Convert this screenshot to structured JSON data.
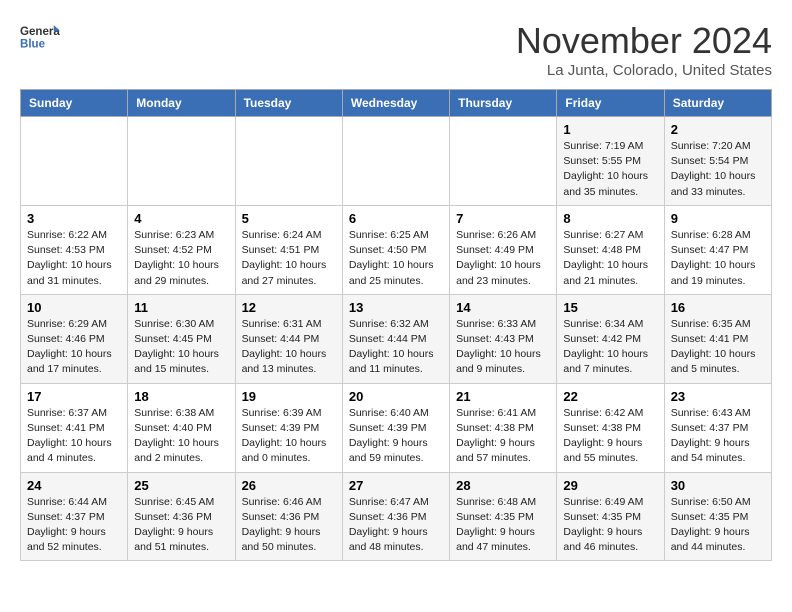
{
  "logo": {
    "line1": "General",
    "line2": "Blue"
  },
  "title": "November 2024",
  "subtitle": "La Junta, Colorado, United States",
  "weekdays": [
    "Sunday",
    "Monday",
    "Tuesday",
    "Wednesday",
    "Thursday",
    "Friday",
    "Saturday"
  ],
  "weeks": [
    [
      {
        "day": "",
        "info": ""
      },
      {
        "day": "",
        "info": ""
      },
      {
        "day": "",
        "info": ""
      },
      {
        "day": "",
        "info": ""
      },
      {
        "day": "",
        "info": ""
      },
      {
        "day": "1",
        "info": "Sunrise: 7:19 AM\nSunset: 5:55 PM\nDaylight: 10 hours\nand 35 minutes."
      },
      {
        "day": "2",
        "info": "Sunrise: 7:20 AM\nSunset: 5:54 PM\nDaylight: 10 hours\nand 33 minutes."
      }
    ],
    [
      {
        "day": "3",
        "info": "Sunrise: 6:22 AM\nSunset: 4:53 PM\nDaylight: 10 hours\nand 31 minutes."
      },
      {
        "day": "4",
        "info": "Sunrise: 6:23 AM\nSunset: 4:52 PM\nDaylight: 10 hours\nand 29 minutes."
      },
      {
        "day": "5",
        "info": "Sunrise: 6:24 AM\nSunset: 4:51 PM\nDaylight: 10 hours\nand 27 minutes."
      },
      {
        "day": "6",
        "info": "Sunrise: 6:25 AM\nSunset: 4:50 PM\nDaylight: 10 hours\nand 25 minutes."
      },
      {
        "day": "7",
        "info": "Sunrise: 6:26 AM\nSunset: 4:49 PM\nDaylight: 10 hours\nand 23 minutes."
      },
      {
        "day": "8",
        "info": "Sunrise: 6:27 AM\nSunset: 4:48 PM\nDaylight: 10 hours\nand 21 minutes."
      },
      {
        "day": "9",
        "info": "Sunrise: 6:28 AM\nSunset: 4:47 PM\nDaylight: 10 hours\nand 19 minutes."
      }
    ],
    [
      {
        "day": "10",
        "info": "Sunrise: 6:29 AM\nSunset: 4:46 PM\nDaylight: 10 hours\nand 17 minutes."
      },
      {
        "day": "11",
        "info": "Sunrise: 6:30 AM\nSunset: 4:45 PM\nDaylight: 10 hours\nand 15 minutes."
      },
      {
        "day": "12",
        "info": "Sunrise: 6:31 AM\nSunset: 4:44 PM\nDaylight: 10 hours\nand 13 minutes."
      },
      {
        "day": "13",
        "info": "Sunrise: 6:32 AM\nSunset: 4:44 PM\nDaylight: 10 hours\nand 11 minutes."
      },
      {
        "day": "14",
        "info": "Sunrise: 6:33 AM\nSunset: 4:43 PM\nDaylight: 10 hours\nand 9 minutes."
      },
      {
        "day": "15",
        "info": "Sunrise: 6:34 AM\nSunset: 4:42 PM\nDaylight: 10 hours\nand 7 minutes."
      },
      {
        "day": "16",
        "info": "Sunrise: 6:35 AM\nSunset: 4:41 PM\nDaylight: 10 hours\nand 5 minutes."
      }
    ],
    [
      {
        "day": "17",
        "info": "Sunrise: 6:37 AM\nSunset: 4:41 PM\nDaylight: 10 hours\nand 4 minutes."
      },
      {
        "day": "18",
        "info": "Sunrise: 6:38 AM\nSunset: 4:40 PM\nDaylight: 10 hours\nand 2 minutes."
      },
      {
        "day": "19",
        "info": "Sunrise: 6:39 AM\nSunset: 4:39 PM\nDaylight: 10 hours\nand 0 minutes."
      },
      {
        "day": "20",
        "info": "Sunrise: 6:40 AM\nSunset: 4:39 PM\nDaylight: 9 hours\nand 59 minutes."
      },
      {
        "day": "21",
        "info": "Sunrise: 6:41 AM\nSunset: 4:38 PM\nDaylight: 9 hours\nand 57 minutes."
      },
      {
        "day": "22",
        "info": "Sunrise: 6:42 AM\nSunset: 4:38 PM\nDaylight: 9 hours\nand 55 minutes."
      },
      {
        "day": "23",
        "info": "Sunrise: 6:43 AM\nSunset: 4:37 PM\nDaylight: 9 hours\nand 54 minutes."
      }
    ],
    [
      {
        "day": "24",
        "info": "Sunrise: 6:44 AM\nSunset: 4:37 PM\nDaylight: 9 hours\nand 52 minutes."
      },
      {
        "day": "25",
        "info": "Sunrise: 6:45 AM\nSunset: 4:36 PM\nDaylight: 9 hours\nand 51 minutes."
      },
      {
        "day": "26",
        "info": "Sunrise: 6:46 AM\nSunset: 4:36 PM\nDaylight: 9 hours\nand 50 minutes."
      },
      {
        "day": "27",
        "info": "Sunrise: 6:47 AM\nSunset: 4:36 PM\nDaylight: 9 hours\nand 48 minutes."
      },
      {
        "day": "28",
        "info": "Sunrise: 6:48 AM\nSunset: 4:35 PM\nDaylight: 9 hours\nand 47 minutes."
      },
      {
        "day": "29",
        "info": "Sunrise: 6:49 AM\nSunset: 4:35 PM\nDaylight: 9 hours\nand 46 minutes."
      },
      {
        "day": "30",
        "info": "Sunrise: 6:50 AM\nSunset: 4:35 PM\nDaylight: 9 hours\nand 44 minutes."
      }
    ]
  ]
}
